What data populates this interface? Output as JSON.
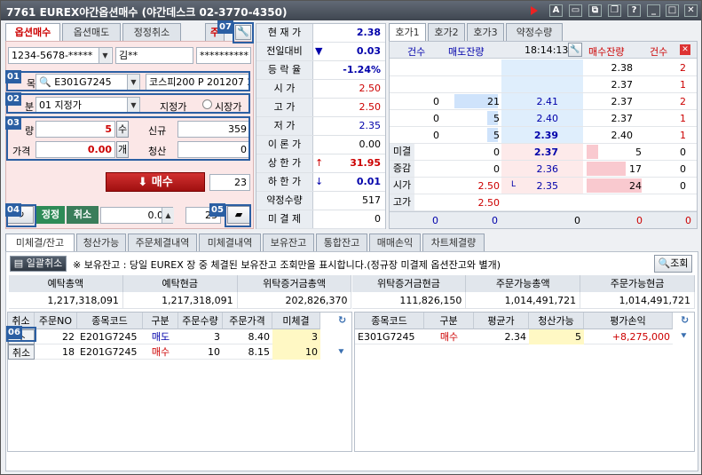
{
  "window": {
    "title": "7761 EUREX야간옵션매수 (야간데스크 02-3770-4350)",
    "btn_a": "A",
    "btn_help": "?",
    "btn_close": "✕"
  },
  "order": {
    "tabs": [
      "옵션매수",
      "옵션매도",
      "정정취소"
    ],
    "extra_tab": "주",
    "account": "1234-5678-*****",
    "name": "김**",
    "password": "**********",
    "code_label": "목",
    "code": "E301G7245",
    "code_name": "코스피200 P 201207 2",
    "type_label": "분",
    "type_value": "01 지정가",
    "radio_limit": "지정가",
    "radio_market": "시장가",
    "qty_label": "량",
    "qty": "5",
    "qty_unit": "수",
    "new_label": "신규",
    "new_val": "359",
    "price_label": "가격",
    "price": "0.00",
    "price_unit": "개",
    "close_label": "청산",
    "close_val": "0",
    "buy_button": "매수",
    "buy_count": "23",
    "modify_button": "정정",
    "cancel_button": "취소",
    "mod_price": "0.00",
    "mod_qty": "23"
  },
  "badges": [
    "01",
    "02",
    "03",
    "04",
    "05",
    "06",
    "07"
  ],
  "quote": {
    "rows": [
      {
        "label": "현 재 가",
        "value": "2.38",
        "cls": "blue",
        "arrow": ""
      },
      {
        "label": "전일대비",
        "value": "0.03",
        "cls": "blue",
        "arrow": "▼"
      },
      {
        "label": "등 락 율",
        "value": "-1.24%",
        "cls": "blue",
        "arrow": ""
      },
      {
        "label": "시 가",
        "value": "2.50",
        "cls": "red",
        "arrow": ""
      },
      {
        "label": "고 가",
        "value": "2.50",
        "cls": "red",
        "arrow": ""
      },
      {
        "label": "저 가",
        "value": "2.35",
        "cls": "blue",
        "arrow": ""
      },
      {
        "label": "이 론 가",
        "value": "0.00",
        "cls": "",
        "arrow": ""
      },
      {
        "label": "상 한 가",
        "value": "31.95",
        "cls": "red",
        "arrow": "↑"
      },
      {
        "label": "하 한 가",
        "value": "0.01",
        "cls": "blue",
        "arrow": "↓"
      },
      {
        "label": "약정수량",
        "value": "517",
        "cls": "",
        "arrow": ""
      },
      {
        "label": "미 결 제",
        "value": "0",
        "cls": "",
        "arrow": ""
      }
    ]
  },
  "book": {
    "tabs": [
      "호가1",
      "호가2",
      "호가3",
      "약정수량"
    ],
    "headers": {
      "cnt": "건수",
      "ask_qty": "매도잔량",
      "time": "18:14:13",
      "bid_qty": "매수잔량",
      "cnt2": "건수"
    },
    "asks": [
      {
        "cnt": "",
        "qty": "",
        "price": "",
        "bq": "2.38",
        "bc": "2"
      },
      {
        "cnt": "",
        "qty": "",
        "price": "",
        "bq": "2.37",
        "bc": "1"
      },
      {
        "cnt": "0",
        "qty": "21",
        "price": "2.41",
        "bq": "2.37",
        "bc": "2"
      },
      {
        "cnt": "0",
        "qty": "5",
        "price": "2.40",
        "bq": "2.37",
        "bc": "1"
      },
      {
        "cnt": "0",
        "qty": "5",
        "price": "2.39",
        "bq": "2.40",
        "bc": "1"
      }
    ],
    "lower": [
      {
        "label": "미결",
        "lv": "0",
        "price": "2.37",
        "bq": "5",
        "bc": "0"
      },
      {
        "label": "증감",
        "lv": "0",
        "price": "2.36",
        "bq": "17",
        "bc": "0"
      },
      {
        "label": "시가",
        "lv": "2.50",
        "price": "2.35",
        "bq": "24",
        "bc": "0"
      },
      {
        "label": "고가",
        "lv": "2.50",
        "price": "",
        "bq": "",
        "bc": ""
      },
      {
        "label": "저가",
        "lv": "2.35",
        "price": "",
        "bq": "",
        "bc": ""
      }
    ],
    "low_marker": "L",
    "totals": {
      "c1": "0",
      "c2": "0",
      "c3": "0",
      "c4": "0",
      "c5": "0"
    }
  },
  "bottom": {
    "tabs": [
      "미체결/잔고",
      "청산가능",
      "주문체결내역",
      "미체결내역",
      "보유잔고",
      "통합잔고",
      "매매손익",
      "차트체결량"
    ],
    "cancel_all": "일괄취소",
    "notice": "※ 보유잔고 : 당일 EUREX 장 중 체결된 보유잔고 조회만을 표시합니다.(정규장 미결제 옵션잔고와 별개)",
    "query": "조회",
    "summary_headers": [
      "예탁총액",
      "예탁현금",
      "위탁증거금총액",
      "위탁증거금현금",
      "주문가능총액",
      "주문가능현금"
    ],
    "summary_values": [
      "1,217,318,091",
      "1,217,318,091",
      "202,826,370",
      "111,826,150",
      "1,014,491,721",
      "1,014,491,721"
    ],
    "left_headers": [
      "취소",
      "주문NO",
      "종목코드",
      "구분",
      "주문수량",
      "주문가격",
      "미체결"
    ],
    "left_rows": [
      {
        "cancel": "소",
        "no": "22",
        "code": "E201G7245",
        "side": "매도",
        "qty": "3",
        "price": "8.40",
        "open": "3"
      },
      {
        "cancel": "취소",
        "no": "18",
        "code": "E201G7245",
        "side": "매수",
        "qty": "10",
        "price": "8.15",
        "open": "10"
      }
    ],
    "right_headers": [
      "종목코드",
      "구분",
      "평균가",
      "청산가능",
      "평가손익"
    ],
    "right_rows": [
      {
        "code": "E301G7245",
        "side": "매수",
        "avg": "2.34",
        "avail": "5",
        "pl": "+8,275,000"
      }
    ]
  }
}
